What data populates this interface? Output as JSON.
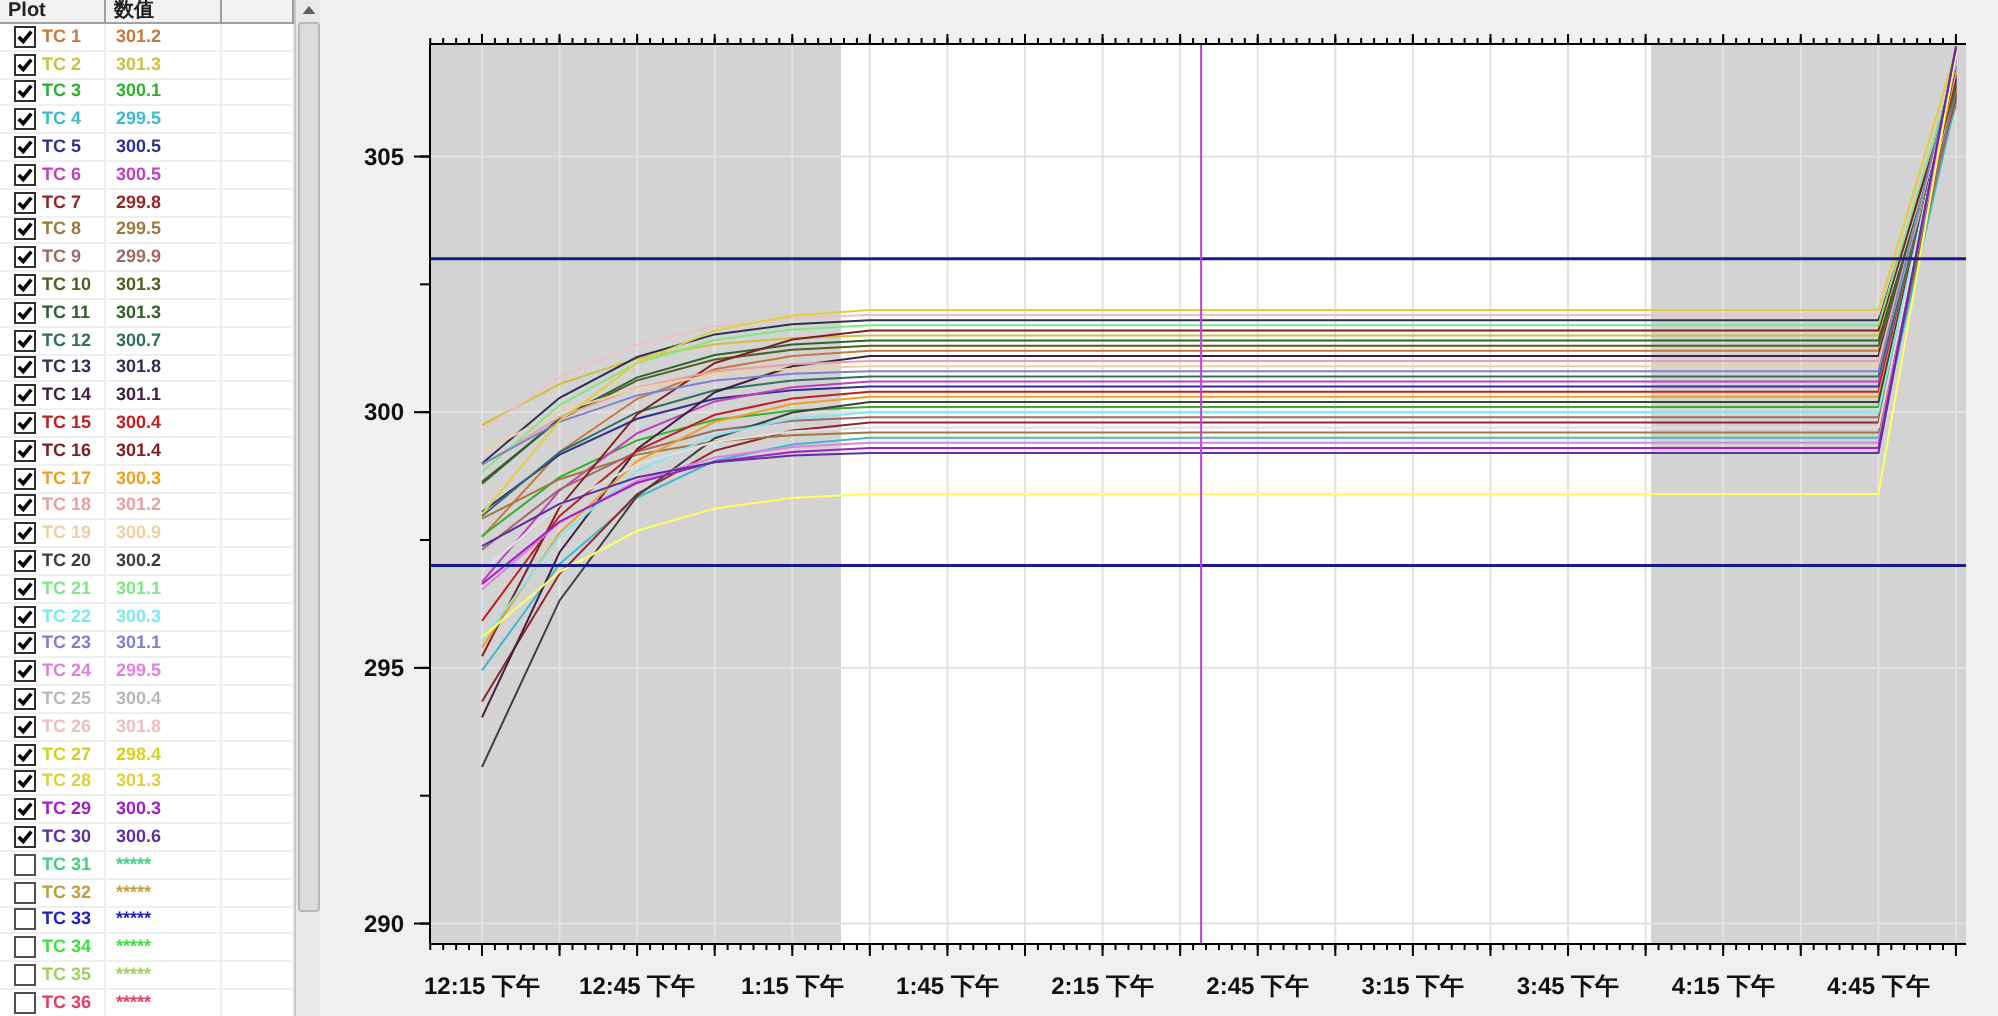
{
  "list": {
    "columns": [
      "Plot",
      "数值"
    ],
    "rows": [
      {
        "label": "TC 1",
        "value": "301.2",
        "checked": true,
        "color": "#c8783c"
      },
      {
        "label": "TC 2",
        "value": "301.3",
        "checked": true,
        "color": "#d0c040"
      },
      {
        "label": "TC 3",
        "value": "300.1",
        "checked": true,
        "color": "#30b030"
      },
      {
        "label": "TC 4",
        "value": "299.5",
        "checked": true,
        "color": "#40b8d0"
      },
      {
        "label": "TC 5",
        "value": "300.5",
        "checked": true,
        "color": "#303090"
      },
      {
        "label": "TC 6",
        "value": "300.5",
        "checked": true,
        "color": "#c040c0"
      },
      {
        "label": "TC 7",
        "value": "299.8",
        "checked": true,
        "color": "#902828"
      },
      {
        "label": "TC 8",
        "value": "299.5",
        "checked": true,
        "color": "#a07840"
      },
      {
        "label": "TC 9",
        "value": "299.9",
        "checked": true,
        "color": "#a06868"
      },
      {
        "label": "TC 10",
        "value": "301.3",
        "checked": true,
        "color": "#506020"
      },
      {
        "label": "TC 11",
        "value": "301.3",
        "checked": true,
        "color": "#306030"
      },
      {
        "label": "TC 12",
        "value": "300.7",
        "checked": true,
        "color": "#307060"
      },
      {
        "label": "TC 13",
        "value": "301.8",
        "checked": true,
        "color": "#303050"
      },
      {
        "label": "TC 14",
        "value": "301.1",
        "checked": true,
        "color": "#402040"
      },
      {
        "label": "TC 15",
        "value": "300.4",
        "checked": true,
        "color": "#c02020"
      },
      {
        "label": "TC 16",
        "value": "301.4",
        "checked": true,
        "color": "#802020"
      },
      {
        "label": "TC 17",
        "value": "300.3",
        "checked": true,
        "color": "#f0a020"
      },
      {
        "label": "TC 18",
        "value": "301.2",
        "checked": true,
        "color": "#e8a0a0"
      },
      {
        "label": "TC 19",
        "value": "300.9",
        "checked": true,
        "color": "#f0d0a0"
      },
      {
        "label": "TC 20",
        "value": "300.2",
        "checked": true,
        "color": "#404040"
      },
      {
        "label": "TC 21",
        "value": "301.1",
        "checked": true,
        "color": "#80e880"
      },
      {
        "label": "TC 22",
        "value": "300.3",
        "checked": true,
        "color": "#80e8f0"
      },
      {
        "label": "TC 23",
        "value": "301.1",
        "checked": true,
        "color": "#8080d0"
      },
      {
        "label": "TC 24",
        "value": "299.5",
        "checked": true,
        "color": "#e080e0"
      },
      {
        "label": "TC 25",
        "value": "300.4",
        "checked": true,
        "color": "#b8b8b8"
      },
      {
        "label": "TC 26",
        "value": "301.8",
        "checked": true,
        "color": "#f0c0c0"
      },
      {
        "label": "TC 27",
        "value": "298.4",
        "checked": true,
        "color": "#d8d020"
      },
      {
        "label": "TC 28",
        "value": "301.3",
        "checked": true,
        "color": "#e0d040"
      },
      {
        "label": "TC 29",
        "value": "300.3",
        "checked": true,
        "color": "#a020c0"
      },
      {
        "label": "TC 30",
        "value": "300.6",
        "checked": true,
        "color": "#6030a0"
      },
      {
        "label": "TC 31",
        "value": "*****",
        "checked": false,
        "color": "#40d080"
      },
      {
        "label": "TC 32",
        "value": "*****",
        "checked": false,
        "color": "#c0a040"
      },
      {
        "label": "TC 33",
        "value": "*****",
        "checked": false,
        "color": "#2020c0"
      },
      {
        "label": "TC 34",
        "value": "*****",
        "checked": false,
        "color": "#40e040"
      },
      {
        "label": "TC 35",
        "value": "*****",
        "checked": false,
        "color": "#a0d060"
      },
      {
        "label": "TC 36",
        "value": "*****",
        "checked": false,
        "color": "#e04060"
      }
    ]
  },
  "chart": {
    "chart_data": {
      "type": "line",
      "grid": true,
      "categories": [
        "12:15 下午",
        null,
        "12:45 下午",
        null,
        "1:15 下午",
        null,
        "1:45 下午",
        null,
        "2:15 下午",
        null,
        "2:45 下午",
        null,
        "3:15 下午",
        null,
        "3:45 下午",
        null,
        "4:15 下午",
        null,
        "4:45 下午",
        null
      ],
      "ylim": [
        289.6,
        307.2
      ],
      "yticks": [
        290,
        295,
        300,
        305
      ],
      "ref_lines": [
        {
          "axis": "y",
          "value": 303,
          "color": "#1a1a8c"
        },
        {
          "axis": "y",
          "value": 297,
          "color": "#1a1a8c"
        }
      ],
      "series": [
        {
          "color": "#c8783c",
          "values": [
            297.56,
            299.22,
            300.26,
            300.84,
            301.1,
            301.2,
            301.2,
            301.2,
            301.2,
            301.2,
            301.2,
            301.2,
            301.2,
            301.2,
            301.2,
            301.2,
            301.2,
            301.2,
            301.2,
            306.0
          ]
        },
        {
          "color": "#d0c040",
          "values": [
            299.75,
            300.55,
            301.05,
            301.33,
            301.45,
            301.5,
            301.5,
            301.5,
            301.5,
            301.5,
            301.5,
            301.5,
            301.5,
            301.5,
            301.5,
            301.5,
            301.5,
            301.5,
            301.5,
            306.04
          ]
        },
        {
          "color": "#30b030",
          "values": [
            297.58,
            298.73,
            299.45,
            299.85,
            300.03,
            300.1,
            300.1,
            300.1,
            300.1,
            300.1,
            300.1,
            300.1,
            300.1,
            300.1,
            300.1,
            300.1,
            300.1,
            300.1,
            300.1,
            306.08
          ]
        },
        {
          "color": "#40b8d0",
          "values": [
            294.95,
            297.03,
            298.33,
            299.05,
            299.37,
            299.5,
            299.5,
            299.5,
            299.5,
            299.5,
            299.5,
            299.5,
            299.5,
            299.5,
            299.5,
            299.5,
            299.5,
            299.5,
            299.5,
            306.12
          ]
        },
        {
          "color": "#303090",
          "values": [
            298.05,
            299.17,
            299.87,
            300.26,
            300.43,
            300.5,
            300.5,
            300.5,
            300.5,
            300.5,
            300.5,
            300.5,
            300.5,
            300.5,
            300.5,
            300.5,
            300.5,
            300.5,
            300.5,
            306.16
          ]
        },
        {
          "color": "#c040c0",
          "values": [
            296.68,
            298.47,
            299.59,
            300.21,
            300.49,
            300.6,
            300.6,
            300.6,
            300.6,
            300.6,
            300.6,
            300.6,
            300.6,
            300.6,
            300.6,
            300.6,
            300.6,
            300.6,
            300.6,
            306.2
          ]
        },
        {
          "color": "#902828",
          "values": [
            294.34,
            296.84,
            298.4,
            299.25,
            299.64,
            299.8,
            299.8,
            299.8,
            299.8,
            299.8,
            299.8,
            299.8,
            299.8,
            299.8,
            299.8,
            299.8,
            299.8,
            299.8,
            299.8,
            306.24
          ]
        },
        {
          "color": "#a07840",
          "values": [
            297.92,
            298.69,
            299.17,
            299.43,
            299.55,
            299.6,
            299.6,
            299.6,
            299.6,
            299.6,
            299.6,
            299.6,
            299.6,
            299.6,
            299.6,
            299.6,
            299.6,
            299.6,
            299.6,
            306.28
          ]
        },
        {
          "color": "#a06868",
          "values": [
            297.31,
            298.49,
            299.23,
            299.64,
            299.83,
            299.9,
            299.9,
            299.9,
            299.9,
            299.9,
            299.9,
            299.9,
            299.9,
            299.9,
            299.9,
            299.9,
            299.9,
            299.9,
            299.9,
            306.32
          ]
        },
        {
          "color": "#506020",
          "values": [
            298.64,
            299.86,
            300.62,
            301.03,
            301.22,
            301.3,
            301.3,
            301.3,
            301.3,
            301.3,
            301.3,
            301.3,
            301.3,
            301.3,
            301.3,
            301.3,
            301.3,
            301.3,
            301.3,
            306.36
          ]
        },
        {
          "color": "#306030",
          "values": [
            298.6,
            299.88,
            300.68,
            301.12,
            301.32,
            301.4,
            301.4,
            301.4,
            301.4,
            301.4,
            301.4,
            301.4,
            301.4,
            301.4,
            301.4,
            301.4,
            301.4,
            301.4,
            301.4,
            306.4
          ]
        },
        {
          "color": "#307060",
          "values": [
            297.97,
            299.22,
            300.0,
            300.43,
            300.62,
            300.7,
            300.7,
            300.7,
            300.7,
            300.7,
            300.7,
            300.7,
            300.7,
            300.7,
            300.7,
            300.7,
            300.7,
            300.7,
            300.7,
            306.44
          ]
        },
        {
          "color": "#303050",
          "values": [
            299.0,
            300.28,
            301.08,
            301.52,
            301.72,
            301.8,
            301.8,
            301.8,
            301.8,
            301.8,
            301.8,
            301.8,
            301.8,
            301.8,
            301.8,
            301.8,
            301.8,
            301.8,
            301.8,
            306.48
          ]
        },
        {
          "color": "#402040",
          "values": [
            294.03,
            297.26,
            299.28,
            300.39,
            300.9,
            301.1,
            301.1,
            301.1,
            301.1,
            301.1,
            301.1,
            301.1,
            301.1,
            301.1,
            301.1,
            301.1,
            301.1,
            301.1,
            301.1,
            306.52
          ]
        },
        {
          "color": "#c02020",
          "values": [
            295.92,
            297.97,
            299.25,
            299.95,
            300.27,
            300.4,
            300.4,
            300.4,
            300.4,
            300.4,
            300.4,
            300.4,
            300.4,
            300.4,
            300.4,
            300.4,
            300.4,
            300.4,
            300.4,
            306.56
          ]
        },
        {
          "color": "#802020",
          "values": [
            295.23,
            298.14,
            299.96,
            300.96,
            301.42,
            301.6,
            301.6,
            301.6,
            301.6,
            301.6,
            301.6,
            301.6,
            301.6,
            301.6,
            301.6,
            301.6,
            301.6,
            301.6,
            301.6,
            306.6
          ]
        },
        {
          "color": "#f0a020",
          "values": [
            295.4,
            297.64,
            299.04,
            299.81,
            300.16,
            300.3,
            300.3,
            300.3,
            300.3,
            300.3,
            300.3,
            300.3,
            300.3,
            300.3,
            300.3,
            300.3,
            300.3,
            300.3,
            300.3,
            306.64
          ]
        },
        {
          "color": "#e8a0a0",
          "values": [
            298.97,
            299.9,
            300.48,
            300.8,
            300.94,
            301.0,
            301.0,
            301.0,
            301.0,
            301.0,
            301.0,
            301.0,
            301.0,
            301.0,
            301.0,
            301.0,
            301.0,
            301.0,
            301.0,
            306.68
          ]
        },
        {
          "color": "#f0d0a0",
          "values": [
            299.22,
            300.01,
            300.47,
            300.73,
            300.85,
            300.9,
            300.9,
            300.9,
            300.9,
            300.9,
            300.9,
            300.9,
            300.9,
            300.9,
            300.9,
            300.9,
            300.9,
            300.9,
            300.9,
            306.72
          ]
        },
        {
          "color": "#404040",
          "values": [
            293.06,
            296.32,
            298.36,
            299.49,
            299.99,
            300.2,
            300.2,
            300.2,
            300.2,
            300.2,
            300.2,
            300.2,
            300.2,
            300.2,
            300.2,
            300.2,
            300.2,
            300.2,
            300.2,
            306.76
          ]
        },
        {
          "color": "#80e880",
          "values": [
            298.83,
            300.14,
            300.96,
            301.41,
            301.62,
            301.7,
            301.7,
            301.7,
            301.7,
            301.7,
            301.7,
            301.7,
            301.7,
            301.7,
            301.7,
            301.7,
            301.7,
            301.7,
            301.7,
            306.8
          ]
        },
        {
          "color": "#80e8f0",
          "values": [
            295.52,
            297.57,
            298.85,
            299.55,
            299.87,
            300.0,
            300.0,
            300.0,
            300.0,
            300.0,
            300.0,
            300.0,
            300.0,
            300.0,
            300.0,
            300.0,
            300.0,
            300.0,
            300.0,
            306.84
          ]
        },
        {
          "color": "#8080d0",
          "values": [
            298.98,
            299.81,
            300.33,
            300.62,
            300.75,
            300.8,
            300.8,
            300.8,
            300.8,
            300.8,
            300.8,
            300.8,
            300.8,
            300.8,
            300.8,
            300.8,
            300.8,
            300.8,
            300.8,
            306.88
          ]
        },
        {
          "color": "#e080e0",
          "values": [
            296.53,
            297.84,
            298.66,
            299.11,
            299.32,
            299.4,
            299.4,
            299.4,
            299.4,
            299.4,
            299.4,
            299.4,
            299.4,
            299.4,
            299.4,
            299.4,
            299.4,
            299.4,
            299.4,
            306.92
          ]
        },
        {
          "color": "#e0e0e0",
          "values": [
            296.9,
            298.18,
            298.98,
            299.42,
            299.62,
            299.7,
            299.7,
            299.7,
            299.7,
            299.7,
            299.7,
            299.7,
            299.7,
            299.7,
            299.7,
            299.7,
            299.7,
            299.7,
            299.7,
            306.96
          ]
        },
        {
          "color": "#f0c0c0",
          "values": [
            299.66,
            300.68,
            301.32,
            301.68,
            301.84,
            301.9,
            301.9,
            301.9,
            301.9,
            301.9,
            301.9,
            301.9,
            301.9,
            301.9,
            301.9,
            301.9,
            301.9,
            301.9,
            301.9,
            307.0
          ]
        },
        {
          "color": "#ffff60",
          "values": [
            295.6,
            296.88,
            297.68,
            298.12,
            298.32,
            298.4,
            298.4,
            298.4,
            298.4,
            298.4,
            298.4,
            298.4,
            298.4,
            298.4,
            298.4,
            298.4,
            298.4,
            298.4,
            298.4,
            307.04
          ]
        },
        {
          "color": "#e0d040",
          "values": [
            298.01,
            299.83,
            300.97,
            301.6,
            301.89,
            302.0,
            302.0,
            302.0,
            302.0,
            302.0,
            302.0,
            302.0,
            302.0,
            302.0,
            302.0,
            302.0,
            302.0,
            302.0,
            302.0,
            307.08
          ]
        },
        {
          "color": "#a020c0",
          "values": [
            296.64,
            297.86,
            298.62,
            299.03,
            299.22,
            299.3,
            299.3,
            299.3,
            299.3,
            299.3,
            299.3,
            299.3,
            299.3,
            299.3,
            299.3,
            299.3,
            299.3,
            299.3,
            299.3,
            307.12
          ]
        },
        {
          "color": "#6030a0",
          "values": [
            297.38,
            298.21,
            298.73,
            299.02,
            299.15,
            299.2,
            299.2,
            299.2,
            299.2,
            299.2,
            299.2,
            299.2,
            299.2,
            299.2,
            299.2,
            299.2,
            299.2,
            299.2,
            299.2,
            307.16
          ]
        }
      ]
    }
  }
}
